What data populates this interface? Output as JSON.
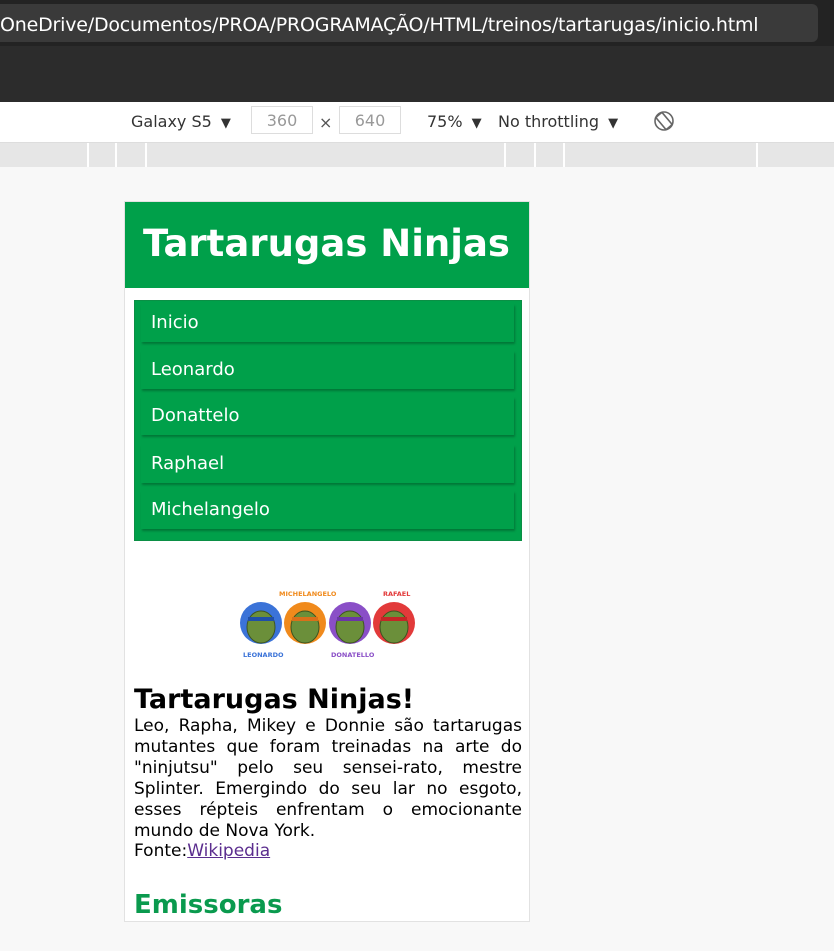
{
  "browser": {
    "url": "OneDrive/Documentos/PROA/PROGRAMAÇÃO/HTML/treinos/tartarugas/inicio.html"
  },
  "device_toolbar": {
    "device": "Galaxy S5",
    "width": "360",
    "times": "×",
    "height": "640",
    "zoom": "75%",
    "throttling": "No throttling"
  },
  "site": {
    "title": "Tartarugas Ninjas",
    "nav": [
      "Inicio",
      "Leonardo",
      "Donattelo",
      "Raphael",
      "Michelangelo"
    ],
    "logo": {
      "labels": [
        "MICHELANGELO",
        "RAFAEL",
        "LEONARDO",
        "DONATELLO"
      ],
      "colors": [
        "#3b73d8",
        "#f08a1c",
        "#8a4fc7",
        "#e23a3a"
      ]
    },
    "article": {
      "title": "Tartarugas Ninjas!",
      "text": "Leo, Rapha, Mikey e Donnie são tartarugas mutantes que foram treinadas na arte do \"ninjutsu\" pelo seu sensei-rato, mestre Splinter. Emergindo do seu lar no esgoto, esses répteis enfrentam o emocionante mundo de Nova York.",
      "source_label": "Fonte:",
      "source_link": "Wikipedia"
    },
    "section_title": "Emissoras"
  }
}
